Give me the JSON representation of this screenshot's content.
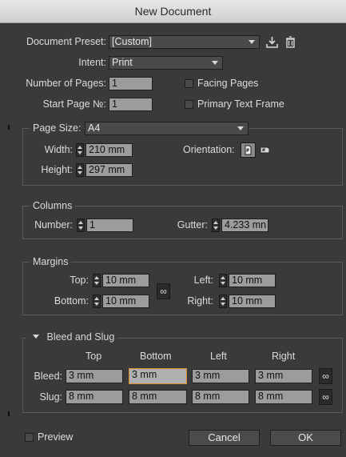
{
  "window": {
    "title": "New Document"
  },
  "preset": {
    "label": "Document Preset:",
    "value": "[Custom]"
  },
  "intent": {
    "label": "Intent:",
    "value": "Print"
  },
  "pages": {
    "label": "Number of Pages:",
    "value": "1"
  },
  "start_page": {
    "label": "Start Page №:",
    "value": "1"
  },
  "facing_pages": {
    "label": "Facing Pages",
    "checked": false
  },
  "primary_text_frame": {
    "label": "Primary Text Frame",
    "checked": false
  },
  "page_size": {
    "label": "Page Size:",
    "value": "A4",
    "width_label": "Width:",
    "width": "210 mm",
    "height_label": "Height:",
    "height": "297 mm",
    "orientation_label": "Orientation:",
    "orientation_selected": "portrait"
  },
  "columns": {
    "title": "Columns",
    "number_label": "Number:",
    "number": "1",
    "gutter_label": "Gutter:",
    "gutter": "4.233 mn"
  },
  "margins": {
    "title": "Margins",
    "top_label": "Top:",
    "top": "10 mm",
    "bottom_label": "Bottom:",
    "bottom": "10 mm",
    "left_label": "Left:",
    "left": "10 mm",
    "right_label": "Right:",
    "right": "10 mm"
  },
  "bleed_slug": {
    "title": "Bleed and Slug",
    "columns": [
      "Top",
      "Bottom",
      "Left",
      "Right"
    ],
    "bleed_label": "Bleed:",
    "bleed": [
      "3 mm",
      "3 mm",
      "3 mm",
      "3 mm"
    ],
    "slug_label": "Slug:",
    "slug": [
      "8 mm",
      "8 mm",
      "8 mm",
      "8 mm"
    ]
  },
  "footer": {
    "preview_label": "Preview",
    "cancel_label": "Cancel",
    "ok_label": "OK"
  },
  "colors": {
    "panel": "#3a3a3a",
    "field": "#9c9c9c",
    "focus_border": "#d9902d"
  }
}
